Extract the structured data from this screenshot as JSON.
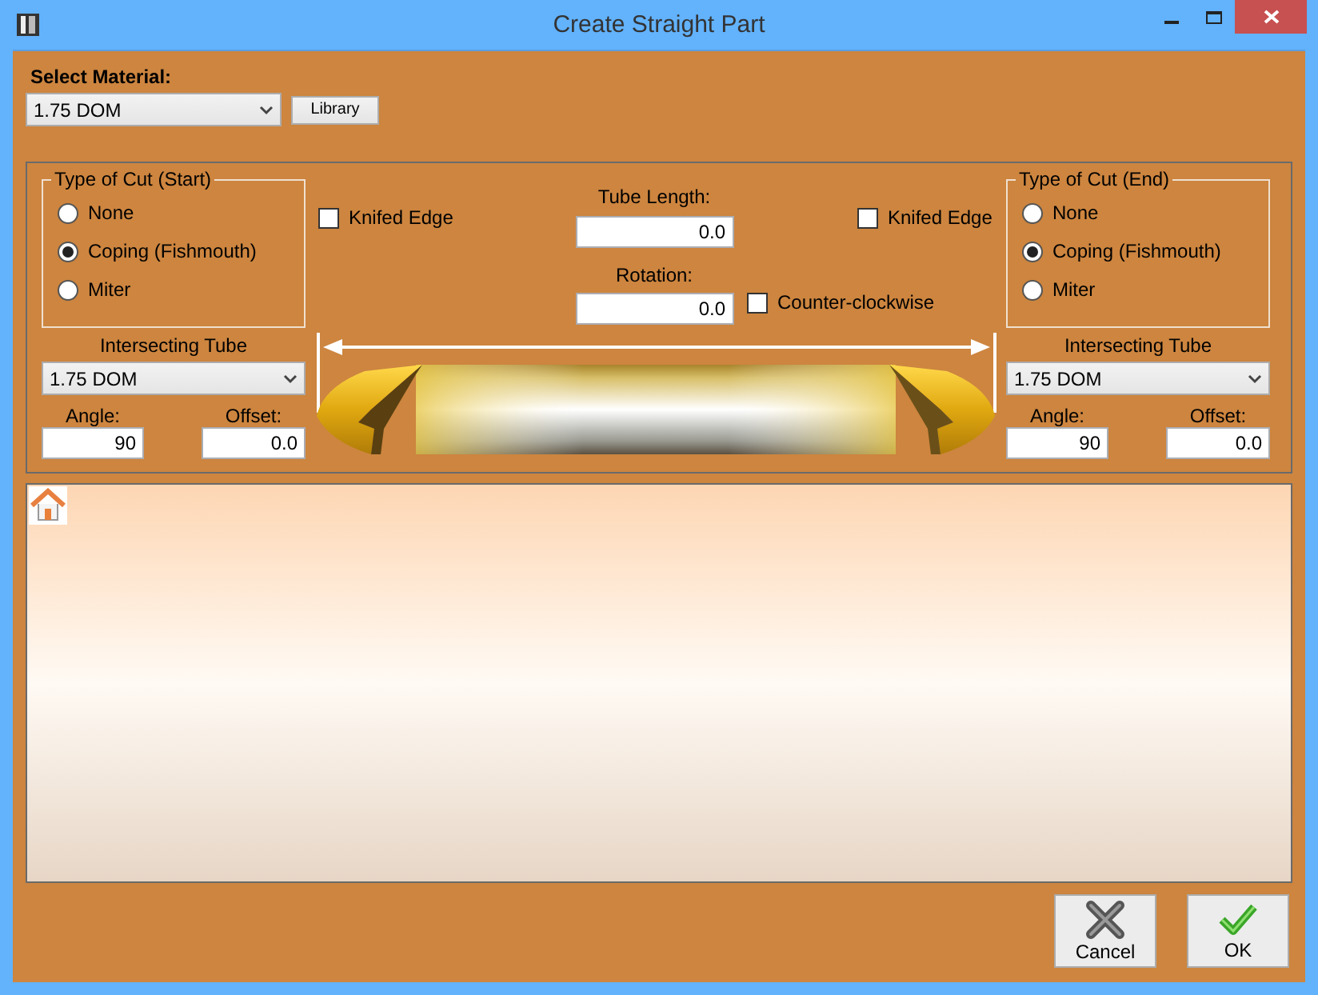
{
  "window": {
    "title": "Create Straight Part"
  },
  "material": {
    "label": "Select Material:",
    "value": "1.75 DOM"
  },
  "library_button": "Library",
  "start": {
    "legend": "Type of Cut (Start)",
    "options": [
      {
        "label": "None",
        "selected": false
      },
      {
        "label": "Coping (Fishmouth)",
        "selected": true
      },
      {
        "label": "Miter",
        "selected": false
      }
    ],
    "knifed_edge": {
      "label": "Knifed Edge",
      "checked": false
    },
    "intersecting": {
      "label": "Intersecting Tube",
      "value": "1.75 DOM"
    },
    "angle": {
      "label": "Angle:",
      "value": "90"
    },
    "offset": {
      "label": "Offset:",
      "value": "0.0"
    }
  },
  "end": {
    "legend": "Type of Cut (End)",
    "options": [
      {
        "label": "None",
        "selected": false
      },
      {
        "label": "Coping (Fishmouth)",
        "selected": true
      },
      {
        "label": "Miter",
        "selected": false
      }
    ],
    "knifed_edge": {
      "label": "Knifed Edge",
      "checked": false
    },
    "intersecting": {
      "label": "Intersecting Tube",
      "value": "1.75 DOM"
    },
    "angle": {
      "label": "Angle:",
      "value": "90"
    },
    "offset": {
      "label": "Offset:",
      "value": "0.0"
    }
  },
  "tube_length": {
    "label": "Tube Length:",
    "value": "0.0"
  },
  "rotation": {
    "label": "Rotation:",
    "value": "0.0"
  },
  "counter_clockwise": {
    "label": "Counter-clockwise",
    "checked": false
  },
  "buttons": [
    {
      "label": "Cancel",
      "kind": "cancel"
    },
    {
      "label": "OK",
      "kind": "ok"
    }
  ]
}
